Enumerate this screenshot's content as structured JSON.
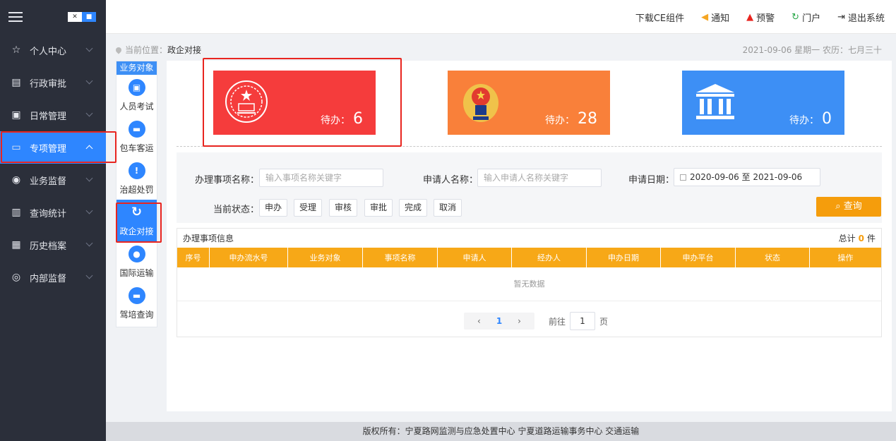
{
  "sidebar": {
    "items": [
      {
        "label": "个人中心",
        "icon": "star-icon"
      },
      {
        "label": "行政审批",
        "icon": "document-check-icon"
      },
      {
        "label": "日常管理",
        "icon": "calendar-icon"
      },
      {
        "label": "专项管理",
        "icon": "folder-icon"
      },
      {
        "label": "业务监督",
        "icon": "eye-icon"
      },
      {
        "label": "查询统计",
        "icon": "bar-chart-icon"
      },
      {
        "label": "历史档案",
        "icon": "books-icon"
      },
      {
        "label": "内部监督",
        "icon": "target-icon"
      }
    ]
  },
  "header": {
    "links": [
      "下载CE组件",
      "通知",
      "预警",
      "门户",
      "退出系统"
    ]
  },
  "breadcrumb": {
    "prefix": "当前位置：",
    "current": "政企对接"
  },
  "date_line": "2021-09-06 星期一 农历：七月三十",
  "subnav": {
    "title": "业务对象",
    "items": [
      "人员考试",
      "包车客运",
      "治超处罚",
      "政企对接",
      "国际运输",
      "驾培查询"
    ]
  },
  "cards": [
    {
      "label": "待办：",
      "count": "6",
      "color": "#f53c3c"
    },
    {
      "label": "待办：",
      "count": "28",
      "color": "#f9803a"
    },
    {
      "label": "待办：",
      "count": "0",
      "color": "#3d8ff5"
    }
  ],
  "filter": {
    "item_name_label": "办理事项名称：",
    "item_name_placeholder": "输入事项名称关键字",
    "applicant_label": "申请人名称：",
    "applicant_placeholder": "输入申请人名称关键字",
    "date_label": "申请日期：",
    "date_value": "2020-09-06 至 2021-09-06",
    "status_label": "当前状态：",
    "status_options": [
      "申办",
      "受理",
      "审核",
      "审批",
      "完成",
      "取消"
    ],
    "query_label": "查询"
  },
  "table": {
    "title": "办理事项信息",
    "total_prefix": "总计",
    "total_count": "0",
    "total_suffix": "件",
    "columns": [
      "序号",
      "申办流水号",
      "业务对象",
      "事项名称",
      "申请人",
      "经办人",
      "申办日期",
      "申办平台",
      "状态",
      "操作"
    ],
    "empty_text": "暂无数据"
  },
  "pagination": {
    "current": "1",
    "goto_label": "前往",
    "goto_value": "1",
    "page_suffix": "页"
  },
  "footer": "版权所有：宁夏路网监测与应急处置中心 宁夏道路运输事务中心 交通运输"
}
